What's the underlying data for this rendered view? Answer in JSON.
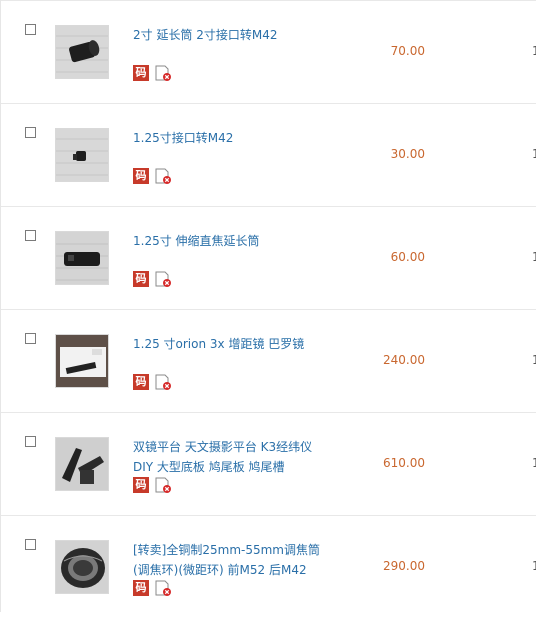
{
  "items": [
    {
      "title_lines": [
        "2寸 延长筒 2寸接口转M42"
      ],
      "price": "70.00",
      "code_label": "码",
      "thumb": "tube-short"
    },
    {
      "title_lines": [
        "1.25寸接口转M42"
      ],
      "price": "30.00",
      "code_label": "码",
      "thumb": "adapter-small"
    },
    {
      "title_lines": [
        "1.25寸 伸缩直焦延长筒"
      ],
      "price": "60.00",
      "code_label": "码",
      "thumb": "tube-long"
    },
    {
      "title_lines": [
        "1.25 寸orion 3x 增距镜 巴罗镜"
      ],
      "price": "240.00",
      "code_label": "码",
      "thumb": "barlow-box"
    },
    {
      "title_lines": [
        "双镜平台 天文摄影平台 K3经纬仪",
        "DIY 大型底板 鸠尾板 鸠尾槽"
      ],
      "price": "610.00",
      "code_label": "码",
      "thumb": "platform"
    },
    {
      "title_lines": [
        "[转卖]全铜制25mm-55mm调焦筒",
        "(调焦环)(微距环)  前M52  后M42"
      ],
      "price": "290.00",
      "code_label": "码",
      "thumb": "focus-ring"
    }
  ],
  "colors": {
    "link": "#2a6fa8",
    "price": "#c9672f",
    "code_badge": "#c73a2a"
  }
}
